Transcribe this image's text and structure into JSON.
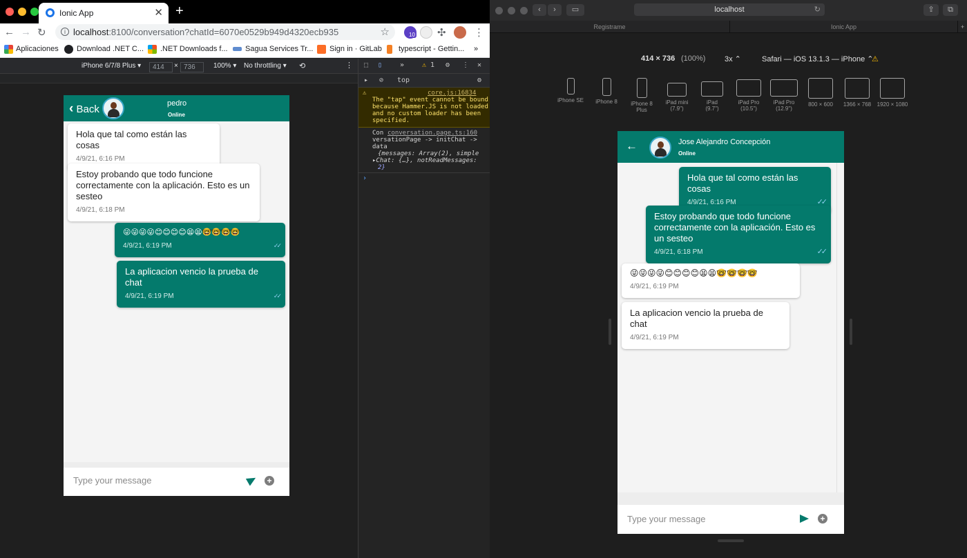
{
  "chrome": {
    "tab_title": "Ionic App",
    "new_tab": "+",
    "url_host": "localhost",
    "url_rest": ":8100/conversation?chatId=6070e0529b949d4320ecb935",
    "bookmarks": [
      {
        "label": "Aplicaciones",
        "color": "#e94335"
      },
      {
        "label": "Download .NET C...",
        "color": "#202124"
      },
      {
        "label": ".NET Downloads f...",
        "color": "#00a4ef"
      },
      {
        "label": "Sagua Services Tr...",
        "color": "#5f8ccf"
      },
      {
        "label": "Sign in · GitLab",
        "color": "#fc6d26"
      },
      {
        "label": "typescript - Gettin...",
        "color": "#f48024"
      }
    ],
    "bookmarks_more": "»",
    "extension_badge": "10",
    "device_toolbar": {
      "device": "iPhone 6/7/8 Plus ▾",
      "width": "414",
      "times": "×",
      "height": "736",
      "zoom": "100% ▾",
      "throttle": "No throttling ▾"
    }
  },
  "left_chat": {
    "back_label": "Back",
    "contact_name": "pedro",
    "status": "Online",
    "input_placeholder": "Type your message",
    "messages": [
      {
        "text": "Hola que tal como están las cosas",
        "time": "4/9/21, 6:16 PM"
      },
      {
        "text": "Estoy probando que todo funcione correctamente con la aplicación. Esto es un sesteo",
        "time": "4/9/21, 6:18 PM"
      },
      {
        "text": "😜😜😜😜😊😊😊😊😫😫🤓🤓🤓🤓",
        "time": "4/9/21, 6:19 PM"
      },
      {
        "text": "La aplicacion vencio la prueba de chat",
        "time": "4/9/21, 6:19 PM"
      }
    ]
  },
  "devtools": {
    "more": "»",
    "warn_count": "1",
    "context": "top",
    "warning_source": "core.js:16834",
    "warning_text": "The \"tap\" event cannot be bound because Hammer.JS is not loaded and no custom loader has been specified.",
    "log_prefix": "Con",
    "log_source": "conversation.page.ts:160",
    "log_line1": "versationPage -> initChat ->",
    "log_line2": "data",
    "log_line3": "{messages: Array(2), simple",
    "log_line4": "Chat: {…}, notReadMessages:",
    "log_line5": "2}",
    "prompt": "›"
  },
  "safari": {
    "address": "localhost",
    "tabs": [
      "Registrame",
      "Ionic App"
    ],
    "new_tab": "+",
    "viewport": "414 × 736",
    "viewport_pct": "(100%)",
    "scale": "3x ⌃",
    "agent": "Safari — iOS 13.1.3 — iPhone ⌃",
    "devices": [
      {
        "label": "iPhone SE"
      },
      {
        "label": "iPhone 8"
      },
      {
        "label": "iPhone 8\nPlus"
      },
      {
        "label": "iPad mini\n(7.9\")"
      },
      {
        "label": "iPad\n(9.7\")"
      },
      {
        "label": "iPad Pro\n(10.5\")"
      },
      {
        "label": "iPad Pro\n(12.9\")"
      },
      {
        "label": "800 × 600"
      },
      {
        "label": "1366 × 768"
      },
      {
        "label": "1920 × 1080"
      }
    ]
  },
  "right_chat": {
    "contact_name": "Jose Alejandro Concepción",
    "status": "Online",
    "input_placeholder": "Type your message",
    "messages": [
      {
        "text": "Hola que tal como están las cosas",
        "time": "4/9/21, 6:16 PM"
      },
      {
        "text": "Estoy probando que todo funcione correctamente con la aplicación. Esto es un sesteo",
        "time": "4/9/21, 6:18 PM"
      },
      {
        "text": "😜😜😜😜😊😊😊😊😫😫🤓🤓🤓🤓",
        "time": "4/9/21, 6:19 PM"
      },
      {
        "text": "La aplicacion vencio la prueba de chat",
        "time": "4/9/21, 6:19 PM"
      }
    ]
  },
  "colors": {
    "brand_teal": "#047a6c",
    "received_bubble": "#ffffff",
    "chat_background": "#f4f4f4",
    "read_tick": "#8fd0f0"
  }
}
